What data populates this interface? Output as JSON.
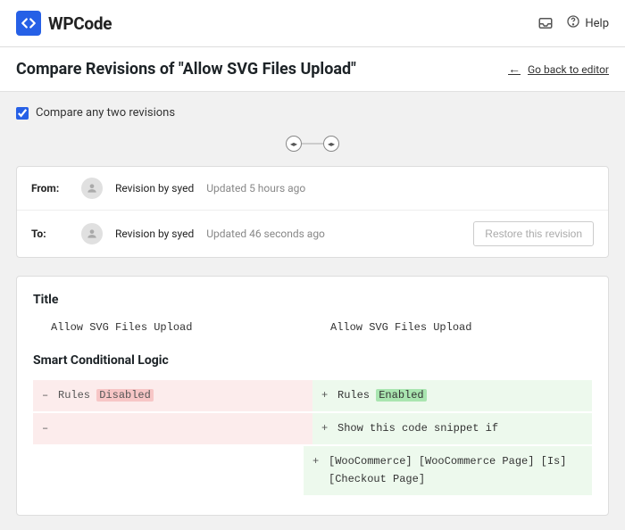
{
  "brand": {
    "name": "WPCode"
  },
  "header": {
    "help_label": "Help"
  },
  "page": {
    "title": "Compare Revisions of \"Allow SVG Files Upload\"",
    "back_label": "Go back to editor"
  },
  "compare": {
    "checkbox_label": "Compare any two revisions",
    "checked": true
  },
  "revisions": {
    "from": {
      "label": "From:",
      "by": "Revision by syed",
      "time": "Updated 5 hours ago"
    },
    "to": {
      "label": "To:",
      "by": "Revision by syed",
      "time": "Updated 46 seconds ago",
      "restore_label": "Restore this revision"
    }
  },
  "diff": {
    "title_section": {
      "heading": "Title",
      "left": "Allow SVG Files Upload",
      "right": "Allow SVG Files Upload"
    },
    "cond_section": {
      "heading": "Smart Conditional Logic",
      "rows": [
        {
          "left": {
            "sign": "–",
            "pre": "Rules ",
            "hl": "Disabled"
          },
          "right": {
            "sign": "+",
            "pre": "Rules ",
            "hl": "Enabled"
          }
        },
        {
          "left": {
            "sign": "–",
            "text": ""
          },
          "right": {
            "sign": "+",
            "text": "Show this code snippet if"
          }
        },
        {
          "left": null,
          "right": {
            "sign": "+",
            "text": "[WooCommerce] [WooCommerce Page] [Is] [Checkout Page]"
          }
        }
      ]
    }
  }
}
